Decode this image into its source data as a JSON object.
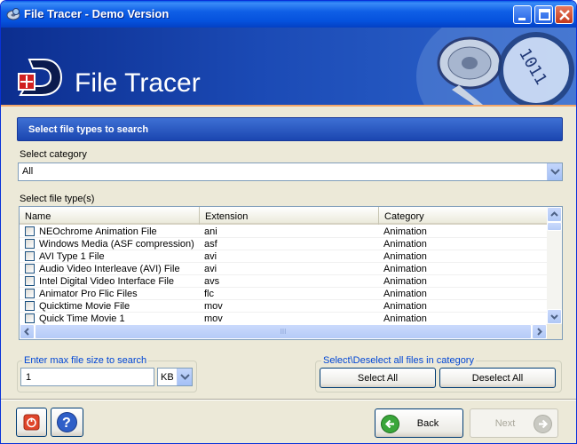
{
  "window": {
    "title": "File Tracer - Demo Version",
    "controls": {
      "minimize": "minimize",
      "maximize": "maximize",
      "close": "close"
    }
  },
  "banner": {
    "app_name": "File Tracer",
    "logo_letter": "D",
    "disc_text": "1011"
  },
  "section": {
    "title": "Select file types to search"
  },
  "category": {
    "label": "Select category",
    "value": "All"
  },
  "filetypes": {
    "label": "Select file type(s)",
    "columns": [
      "Name",
      "Extension",
      "Category"
    ],
    "rows": [
      {
        "name": "NEOchrome Animation File",
        "ext": "ani",
        "category": "Animation",
        "checked": false
      },
      {
        "name": "Windows Media (ASF compression)",
        "ext": "asf",
        "category": "Animation",
        "checked": false
      },
      {
        "name": "AVI Type 1 File",
        "ext": "avi",
        "category": "Animation",
        "checked": false
      },
      {
        "name": "Audio Video Interleave (AVI) File",
        "ext": "avi",
        "category": "Animation",
        "checked": false
      },
      {
        "name": "Intel Digital Video Interface File",
        "ext": "avs",
        "category": "Animation",
        "checked": false
      },
      {
        "name": "Animator Pro Flic Files",
        "ext": "flc",
        "category": "Animation",
        "checked": false
      },
      {
        "name": "Quicktime Movie File",
        "ext": "mov",
        "category": "Animation",
        "checked": false
      },
      {
        "name": "Quick Time Movie 1",
        "ext": "mov",
        "category": "Animation",
        "checked": false
      }
    ],
    "hscroll_grip": "III"
  },
  "maxsize": {
    "group_label": "Enter max file size to search",
    "value": "1",
    "unit": "KB"
  },
  "selection": {
    "group_label": "Select\\Deselect all files in category",
    "select_all": "Select All",
    "deselect_all": "Deselect All"
  },
  "footer": {
    "back": "Back",
    "next": "Next"
  },
  "colors": {
    "titlebar": "#0552DD",
    "banner": "#1B4AB5",
    "section_header": "#2A5BC4",
    "group_title": "#0046D5",
    "accent_orange": "#F3A86A"
  },
  "icons": {
    "app": "magnifier-disc-icon",
    "power": "power-icon",
    "help": "help-icon",
    "back": "back-arrow-icon",
    "next": "next-arrow-icon"
  }
}
